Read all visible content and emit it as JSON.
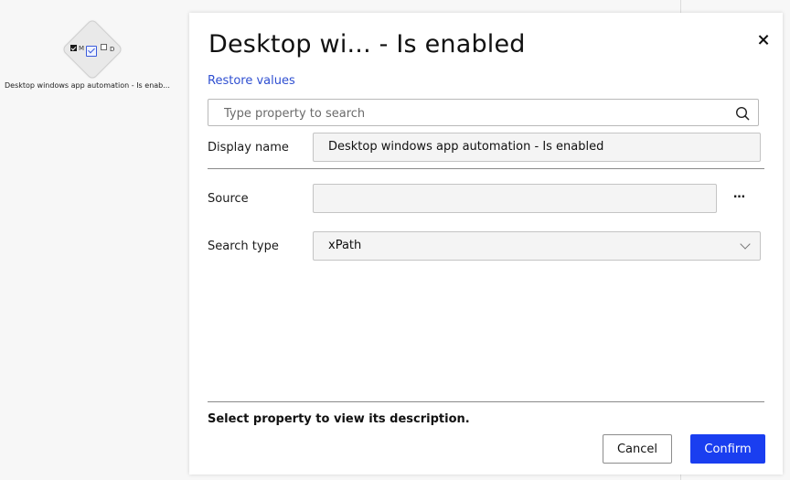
{
  "canvas": {
    "node": {
      "label": "Desktop windows app automation - Is enab...",
      "icon_left_text": "M",
      "icon_right_text": "D"
    }
  },
  "panel": {
    "title": "Desktop wi... - Is enabled",
    "restore_label": "Restore values",
    "search_placeholder": "Type property to search",
    "properties": {
      "display_name": {
        "label": "Display name",
        "value": "Desktop windows app automation - Is enabled"
      },
      "source": {
        "label": "Source",
        "value": "",
        "more": "…"
      },
      "search_type": {
        "label": "Search type",
        "value": "xPath"
      }
    },
    "description": "Select property to view its description.",
    "buttons": {
      "cancel": "Cancel",
      "confirm": "Confirm"
    }
  },
  "colors": {
    "accent": "#1a3ef0",
    "link": "#2f4fd1"
  }
}
